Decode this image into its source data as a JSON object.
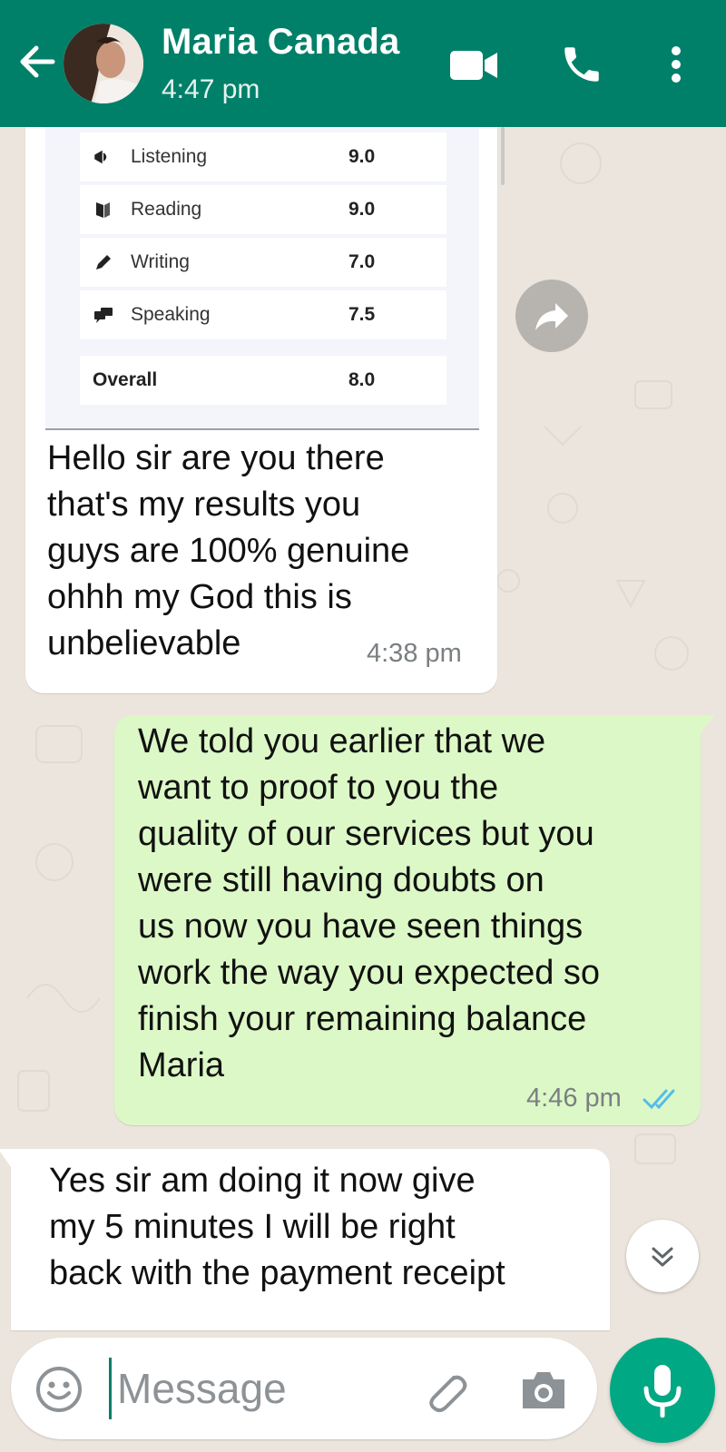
{
  "header": {
    "contact_name": "Maria Canada",
    "last_seen": "4:47 pm"
  },
  "messages": {
    "incoming_1": {
      "scores": [
        {
          "icon": "listening-icon",
          "label": "Listening",
          "value": "9.0"
        },
        {
          "icon": "reading-icon",
          "label": "Reading",
          "value": "9.0"
        },
        {
          "icon": "writing-icon",
          "label": "Writing",
          "value": "7.0"
        },
        {
          "icon": "speaking-icon",
          "label": "Speaking",
          "value": "7.5"
        }
      ],
      "overall_label": "Overall",
      "overall_value": "8.0",
      "lines": [
        "Hello sir are you there",
        "that's my results you",
        "guys are 100% genuine",
        "ohhh my God this is",
        "unbelievable"
      ],
      "time": "4:38 pm"
    },
    "outgoing_1": {
      "lines": [
        "We told you earlier  that we",
        "want to proof to you the",
        "quality of our services but you",
        "were still having doubts on",
        "us now you have seen things",
        "work the way you expected so",
        "finish your remaining balance",
        "Maria"
      ],
      "time": "4:46 pm",
      "status": "read",
      "status_color": "#53BDEB"
    },
    "incoming_2": {
      "lines": [
        "Yes sir am doing it now give",
        "my 5 minutes I will be right",
        "back with the payment receipt"
      ]
    }
  },
  "composer": {
    "placeholder": "Message"
  },
  "colors": {
    "header": "#008069",
    "outgoing_bubble": "#DCF8C6",
    "chat_background": "#ECE5DD",
    "mic_button": "#00A884"
  }
}
